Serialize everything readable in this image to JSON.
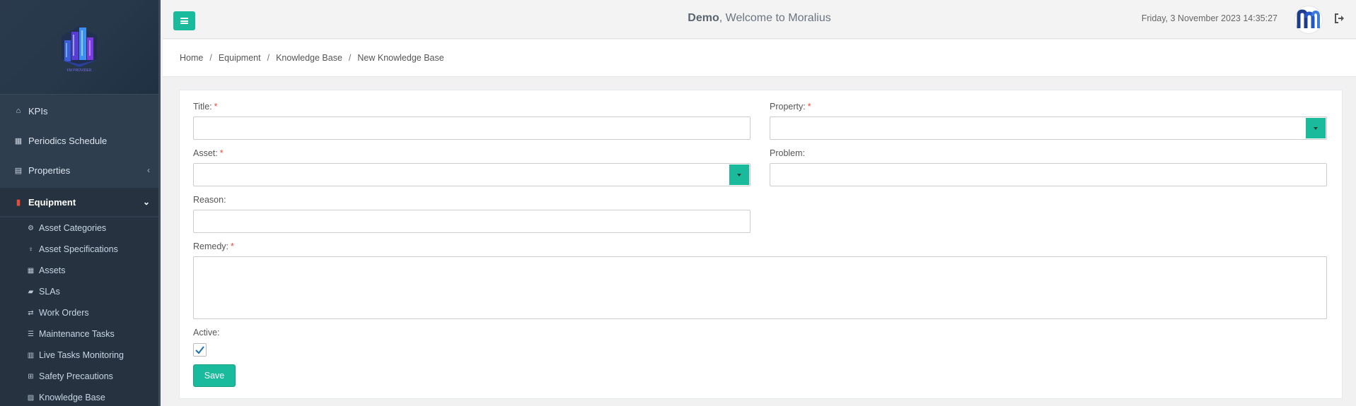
{
  "app": {
    "brand_color": "#1abb9c",
    "sidebar_bg": "#2f3e4e",
    "required_color": "#e74c3c"
  },
  "sidebar": {
    "logo_text": "FM PROVIDER",
    "items": [
      {
        "label": "KPIs",
        "icon": "home-icon"
      },
      {
        "label": "Periodics Schedule",
        "icon": "calendar-icon"
      },
      {
        "label": "Properties",
        "icon": "building-icon"
      },
      {
        "label": "Equipment",
        "icon": "equipment-icon"
      }
    ],
    "sub_items": [
      {
        "label": "Asset Categories",
        "icon": "cogs-icon"
      },
      {
        "label": "Asset Specifications",
        "icon": "lightbulb-icon"
      },
      {
        "label": "Assets",
        "icon": "grid-icon"
      },
      {
        "label": "SLAs",
        "icon": "truck-icon"
      },
      {
        "label": "Work Orders",
        "icon": "retweet-icon"
      },
      {
        "label": "Maintenance Tasks",
        "icon": "tasks-icon"
      },
      {
        "label": "Live Tasks Monitoring",
        "icon": "map-icon"
      },
      {
        "label": "Safety Precautions",
        "icon": "medkit-icon"
      },
      {
        "label": "Knowledge Base",
        "icon": "book-icon"
      }
    ]
  },
  "header": {
    "user": "Demo",
    "welcome_suffix": ", Welcome to Moralius",
    "datetime": "Friday, 3 November 2023 14:35:27"
  },
  "breadcrumb": [
    "Home",
    "Equipment",
    "Knowledge Base",
    "New Knowledge Base"
  ],
  "form": {
    "title_label": "Title:",
    "property_label": "Property:",
    "asset_label": "Asset:",
    "problem_label": "Problem:",
    "reason_label": "Reason:",
    "remedy_label": "Remedy:",
    "active_label": "Active:",
    "required_mark": "*",
    "title_value": "",
    "property_value": "",
    "asset_value": "",
    "problem_value": "",
    "reason_value": "",
    "remedy_value": "",
    "active_checked": true,
    "save_label": "Save"
  }
}
